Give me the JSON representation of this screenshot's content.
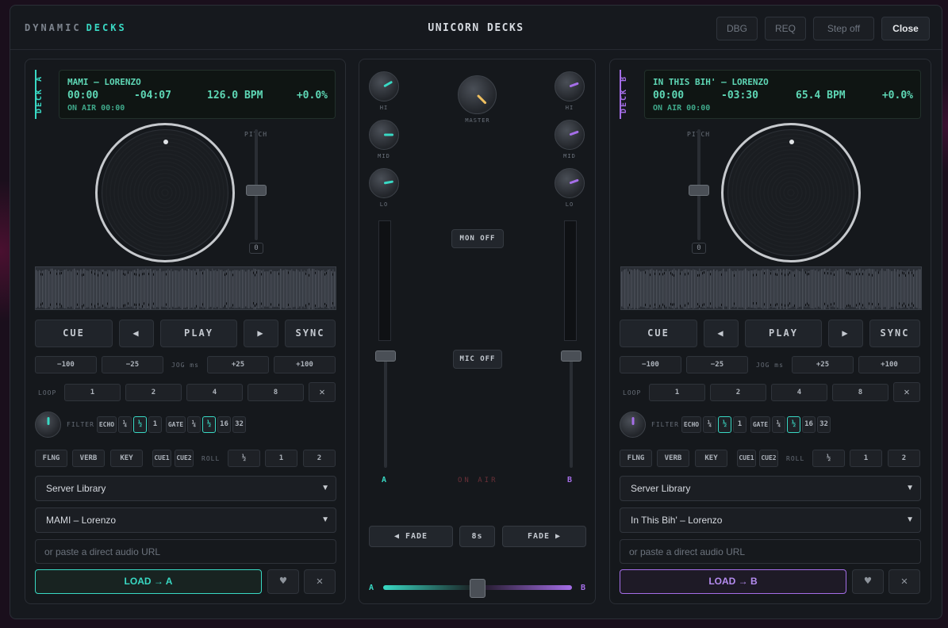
{
  "header": {
    "brand_prefix": "DYNAMIC",
    "brand_accent": "DECKS",
    "title": "UNICORN DECKS",
    "buttons": {
      "dbg": "DBG",
      "req": "REQ",
      "step_off": "Step off",
      "close": "Close"
    }
  },
  "colors": {
    "deck_a_accent": "#39d9c4",
    "deck_b_accent": "#a56ee8",
    "panel_bg": "#15181c"
  },
  "deck_a": {
    "label": "DECK A",
    "track": "MAMI — LORENZO",
    "elapsed": "00:00",
    "remaining": "-04:07",
    "bpm": "126.0 BPM",
    "pitch_pct": "+0.0%",
    "on_air": "ON AIR 00:00",
    "pitch_label": "PITCH",
    "pitch_value": "0",
    "transport": {
      "cue": "CUE",
      "back": "◀",
      "play": "PLAY",
      "fwd": "▶",
      "sync": "SYNC"
    },
    "jog": {
      "m100": "−100",
      "m25": "−25",
      "label": "JOG ms",
      "p25": "+25",
      "p100": "+100"
    },
    "loop": {
      "label": "LOOP",
      "b1": "1",
      "b2": "2",
      "b4": "4",
      "b8": "8",
      "clear": "✕"
    },
    "fx": {
      "filter": "FILTER",
      "echo": "ECHO",
      "q": "¼",
      "h": "½",
      "one": "1",
      "gate": "GATE",
      "gq": "¼",
      "gh": "½",
      "g16": "16",
      "g32": "32"
    },
    "fx2": {
      "flng": "FLNG",
      "verb": "VERB",
      "key": "KEY",
      "cue1": "CUE1",
      "cue2": "CUE2",
      "roll": "ROLL",
      "rh": "½",
      "r1": "1",
      "r2": "2"
    },
    "library": "Server Library",
    "selected_track": "MAMI – Lorenzo",
    "url_placeholder": "or paste a direct audio URL",
    "load": "LOAD → A",
    "fav": "♥",
    "clear": "✕"
  },
  "deck_b": {
    "label": "DECK B",
    "track": "IN THIS BIH' — LORENZO",
    "elapsed": "00:00",
    "remaining": "-03:30",
    "bpm": "65.4 BPM",
    "pitch_pct": "+0.0%",
    "on_air": "ON AIR 00:00",
    "pitch_label": "PITCH",
    "pitch_value": "0",
    "transport": {
      "cue": "CUE",
      "back": "◀",
      "play": "PLAY",
      "fwd": "▶",
      "sync": "SYNC"
    },
    "jog": {
      "m100": "−100",
      "m25": "−25",
      "label": "JOG ms",
      "p25": "+25",
      "p100": "+100"
    },
    "loop": {
      "label": "LOOP",
      "b1": "1",
      "b2": "2",
      "b4": "4",
      "b8": "8",
      "clear": "✕"
    },
    "fx": {
      "filter": "FILTER",
      "echo": "ECHO",
      "q": "¼",
      "h": "½",
      "one": "1",
      "gate": "GATE",
      "gq": "¼",
      "gh": "½",
      "g16": "16",
      "g32": "32"
    },
    "fx2": {
      "flng": "FLNG",
      "verb": "VERB",
      "key": "KEY",
      "cue1": "CUE1",
      "cue2": "CUE2",
      "roll": "ROLL",
      "rh": "½",
      "r1": "1",
      "r2": "2"
    },
    "library": "Server Library",
    "selected_track": "In This Bih' – Lorenzo",
    "url_placeholder": "or paste a direct audio URL",
    "load": "LOAD → B",
    "fav": "♥",
    "clear": "✕"
  },
  "mixer": {
    "hi": "HI",
    "mid": "MID",
    "lo": "LO",
    "master": "MASTER",
    "mon": "MON OFF",
    "mic": "MIC OFF",
    "on_air": "ON AIR",
    "ch_a": "A",
    "ch_b": "B",
    "fade_left": "◀ FADE",
    "fade_time": "8s",
    "fade_right": "FADE ▶",
    "xfade_a": "A",
    "xfade_b": "B",
    "crossfader_position": 0.5
  }
}
